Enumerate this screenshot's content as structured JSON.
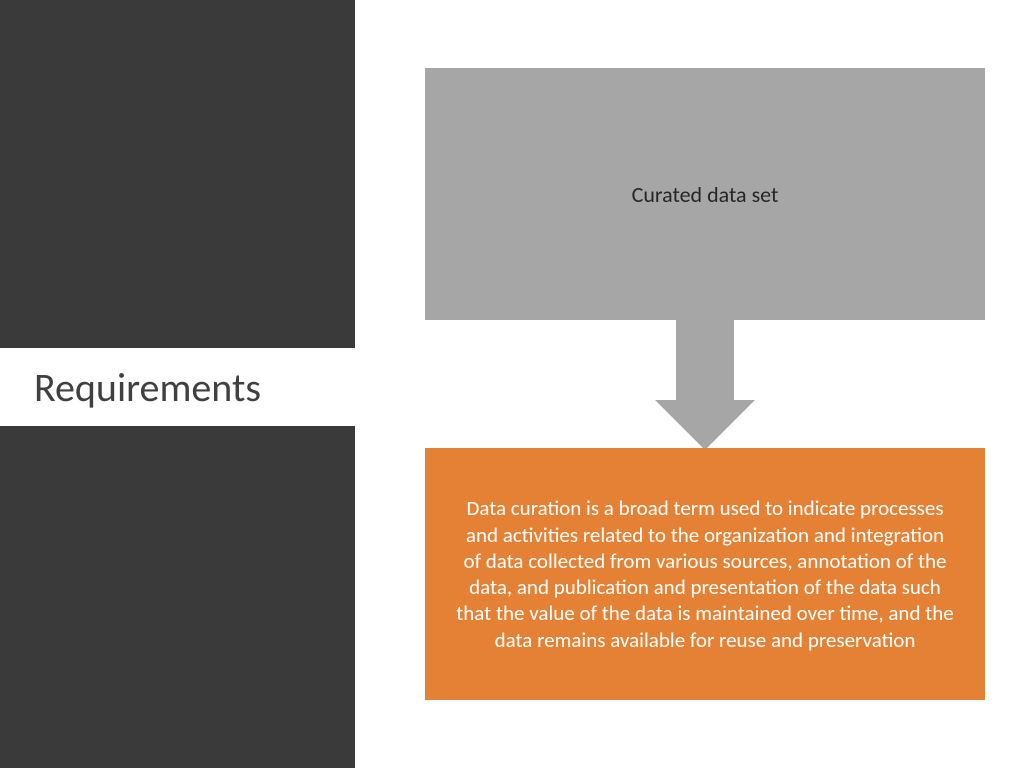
{
  "sidebar": {
    "title": "Requirements"
  },
  "diagram": {
    "top_label": "Curated data set",
    "bottom_text": "Data curation is a broad term used to indicate processes and activities related to the organization and integration of data collected from various sources, annotation of the data, and publication and presentation of the data such that the value of the data is maintained over time, and the data remains available for reuse and preservation"
  },
  "colors": {
    "sidebar_bg": "#3a3a3a",
    "top_box_bg": "#a6a6a6",
    "bottom_box_bg": "#e48135",
    "arrow_fill": "#a6a6a6"
  }
}
